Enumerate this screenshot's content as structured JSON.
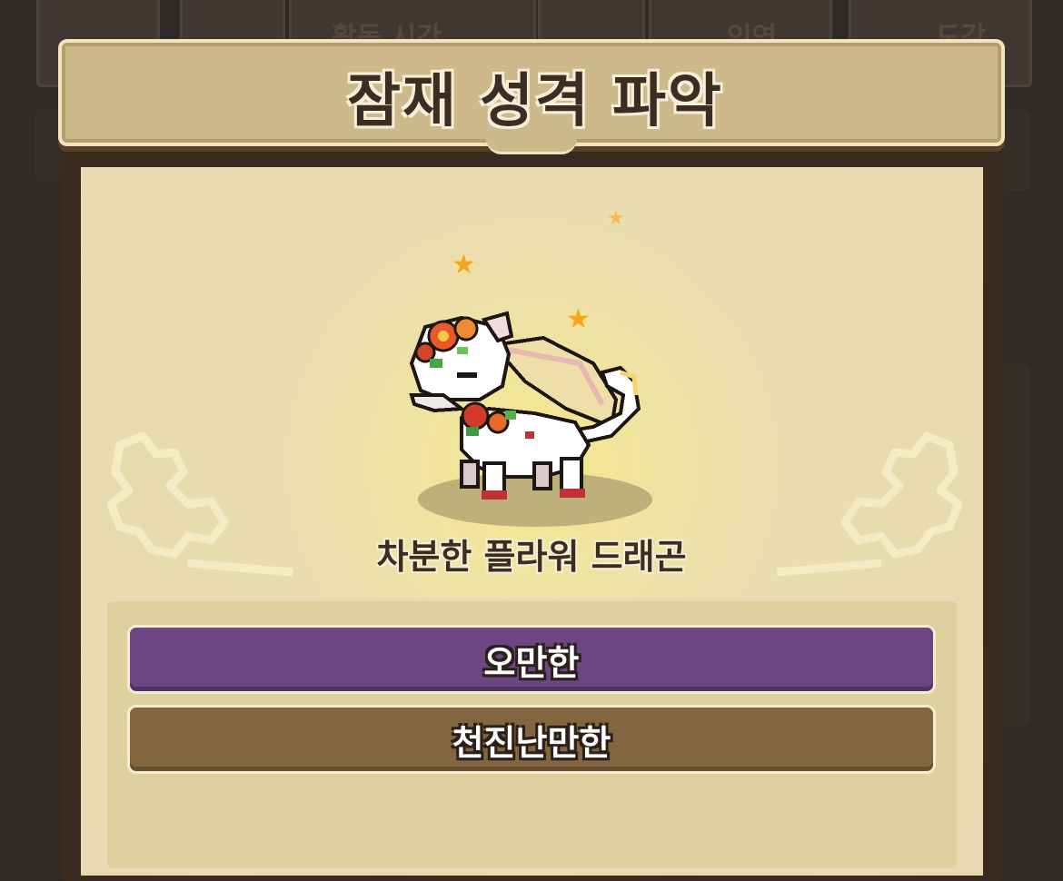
{
  "modal": {
    "title": "잠재 성격 파악",
    "creature_name": "차분한 플라워 드래곤",
    "traits": [
      {
        "label": "오만한",
        "color": "#6b4682"
      },
      {
        "label": "천진난만한",
        "color": "#83653f"
      }
    ]
  },
  "background": {
    "tab_labels": [
      "활동 시간",
      "인연",
      "도감"
    ]
  }
}
